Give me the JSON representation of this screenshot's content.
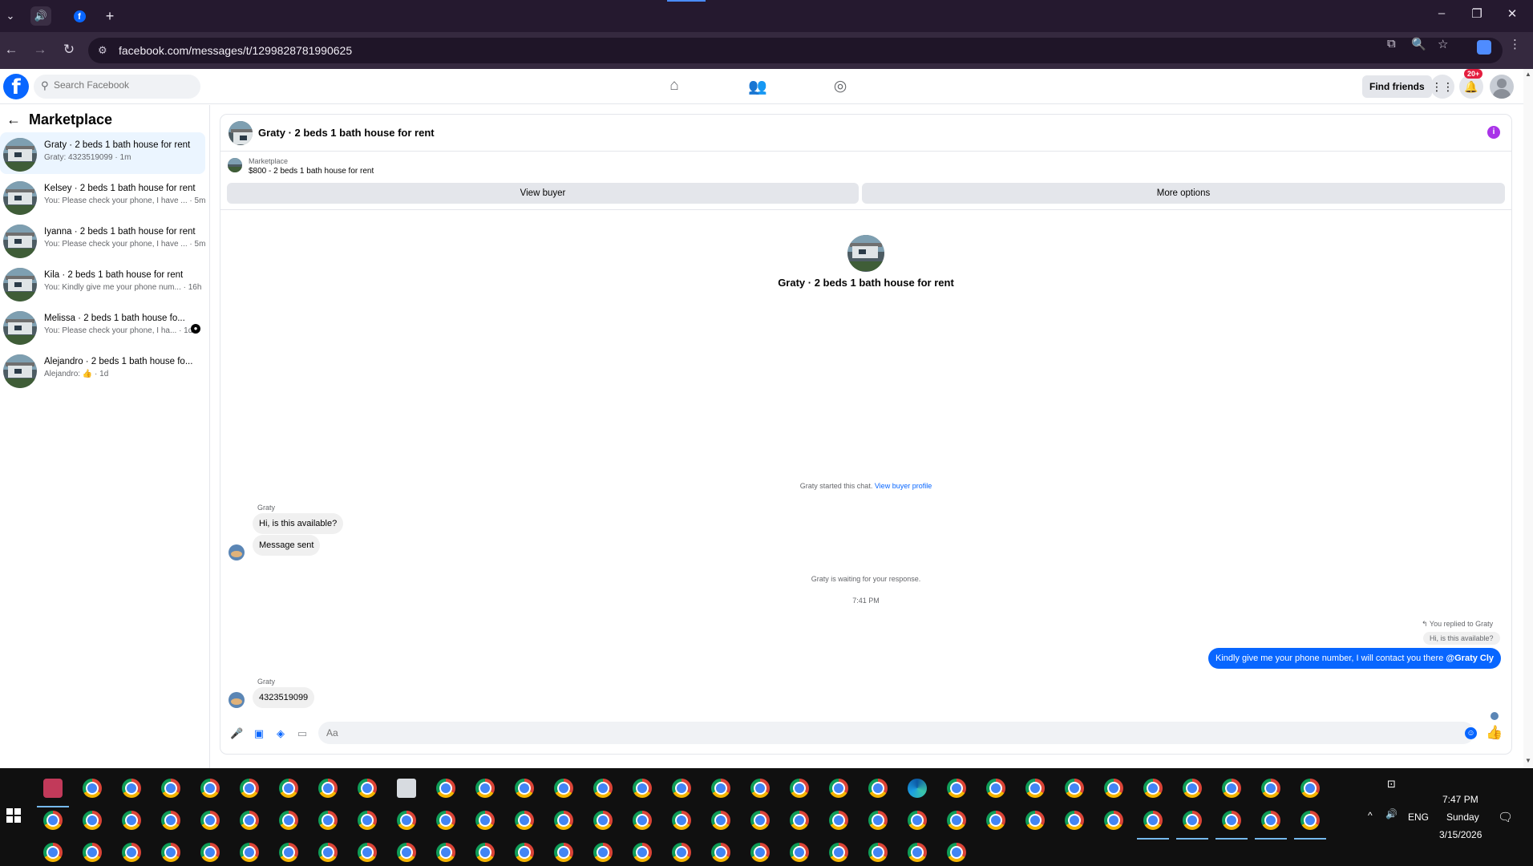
{
  "browser": {
    "url": "facebook.com/messages/t/1299828781990625"
  },
  "fb": {
    "search_placeholder": "Search Facebook",
    "find_friends": "Find friends",
    "notif_count": "20+"
  },
  "sidebar": {
    "title": "Marketplace",
    "conversations": [
      {
        "name": "Graty · 2 beds 1 bath house for rent",
        "snippet": "Graty: 4323519099 · 1m"
      },
      {
        "name": "Kelsey · 2 beds 1 bath house for rent",
        "snippet": "You: Please check your phone, I have ... · 5m"
      },
      {
        "name": "Iyanna · 2 beds 1 bath house for rent",
        "snippet": "You: Please check your phone, I have ... · 5m"
      },
      {
        "name": "Kila · 2 beds 1 bath house for rent",
        "snippet": "You: Kindly give me your phone num... · 16h"
      },
      {
        "name": "Melissa · 2 beds 1 bath house fo...",
        "snippet": "You: Please check your phone, I ha... · 1d"
      },
      {
        "name": "Alejandro · 2 beds 1 bath house fo...",
        "snippet": "Alejandro: 👍 · 1d"
      }
    ]
  },
  "chat": {
    "header_title": "Graty · 2 beds 1 bath house for rent",
    "listing_category": "Marketplace",
    "listing_desc": "$800 - 2 beds 1 bath house for rent",
    "view_buyer": "View buyer",
    "more_options": "More options",
    "center_title": "Graty · 2 beds 1 bath house for rent",
    "started_text": "Graty started this chat.",
    "view_buyer_profile": "View buyer profile",
    "sender_name_1": "Graty",
    "msg_in_1": "Hi, is this available?",
    "msg_in_2": "Message sent",
    "waiting_text": "Graty is waiting for your response.",
    "time_stamp": "7:41 PM",
    "replied_note": "You replied to Graty",
    "replied_quote": "Hi, is this available?",
    "msg_out_1": "Kindly give me your phone number, I will contact you there",
    "msg_out_mention": "@Graty Cly",
    "sender_name_2": "Graty",
    "msg_in_3": "4323519099",
    "composer_placeholder": "Aa"
  },
  "taskbar": {
    "time": "7:47 PM",
    "day": "Sunday",
    "date": "3/15/2026",
    "lang": "ENG"
  },
  "colors": {
    "fb_blue": "#0866ff",
    "chrome_bar": "#25192f",
    "taskbar": "#101010"
  }
}
